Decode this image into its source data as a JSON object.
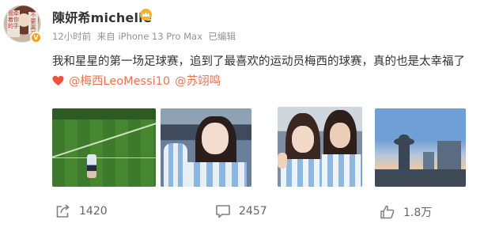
{
  "post": {
    "avatar_text_left": "我牵着你的手",
    "avatar_text_right": "不要离开",
    "username": "陳妍希michelle",
    "time": "12小时前",
    "source": "来自 iPhone 13 Pro Max",
    "edited": "已编辑",
    "text": "我和星星的第一场足球赛，追到了最喜欢的运动员梅西的球赛，真的也是太幸福了",
    "mentions": [
      "@梅西LeoMessi10",
      "@苏翊鸣"
    ],
    "heart_color": "#f0533a",
    "mention_color": "#eb7350"
  },
  "actions": {
    "share_count": "1420",
    "comment_count": "2457",
    "like_count": "1.8万"
  },
  "icons": {
    "crown": "crown-badge-icon",
    "verified": "verified-badge-icon",
    "share": "share-icon",
    "comment": "comment-icon",
    "like": "thumbs-up-icon",
    "heart": "heart-icon"
  }
}
